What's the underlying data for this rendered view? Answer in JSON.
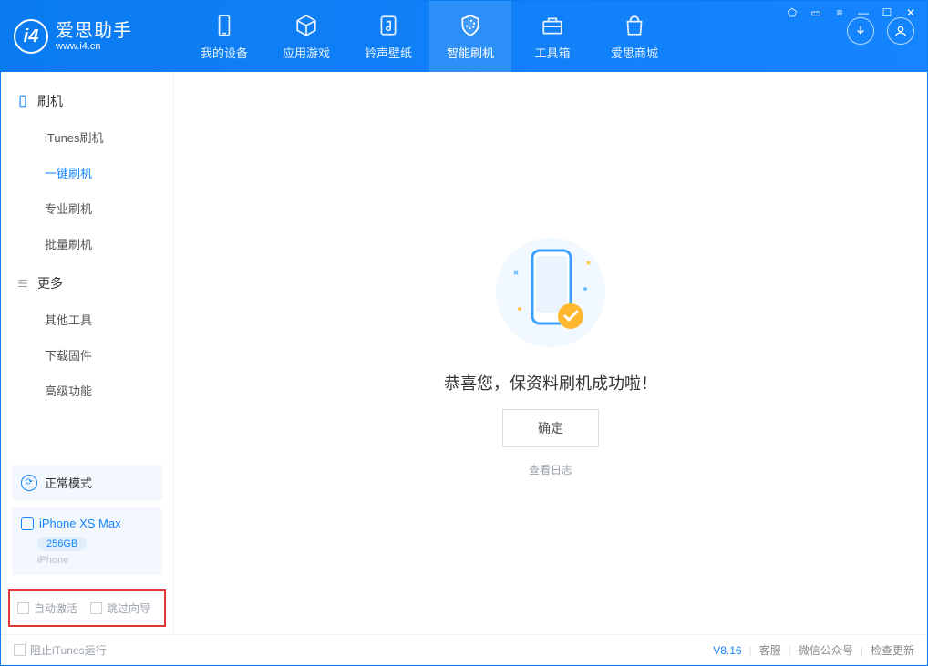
{
  "titlebar": {
    "icons": [
      "shirt",
      "book",
      "menu",
      "min",
      "max",
      "close"
    ]
  },
  "brand": {
    "name": "爱思助手",
    "url": "www.i4.cn"
  },
  "nav": [
    {
      "label": "我的设备",
      "icon": "phone"
    },
    {
      "label": "应用游戏",
      "icon": "cube"
    },
    {
      "label": "铃声壁纸",
      "icon": "music"
    },
    {
      "label": "智能刷机",
      "icon": "shield",
      "active": true
    },
    {
      "label": "工具箱",
      "icon": "briefcase"
    },
    {
      "label": "爱思商城",
      "icon": "bag"
    }
  ],
  "sidebar": {
    "cat1": {
      "label": "刷机",
      "items": [
        "iTunes刷机",
        "一键刷机",
        "专业刷机",
        "批量刷机"
      ],
      "activeIndex": 1
    },
    "cat2": {
      "label": "更多",
      "items": [
        "其他工具",
        "下载固件",
        "高级功能"
      ]
    }
  },
  "mode": {
    "label": "正常模式"
  },
  "device": {
    "name": "iPhone XS Max",
    "storage": "256GB",
    "type": "iPhone"
  },
  "options": {
    "autoActivate": "自动激活",
    "skipGuide": "跳过向导"
  },
  "main": {
    "successMsg": "恭喜您，保资料刷机成功啦！",
    "okBtn": "确定",
    "viewLog": "查看日志"
  },
  "footer": {
    "blockItunes": "阻止iTunes运行",
    "version": "V8.16",
    "links": [
      "客服",
      "微信公众号",
      "检查更新"
    ]
  }
}
